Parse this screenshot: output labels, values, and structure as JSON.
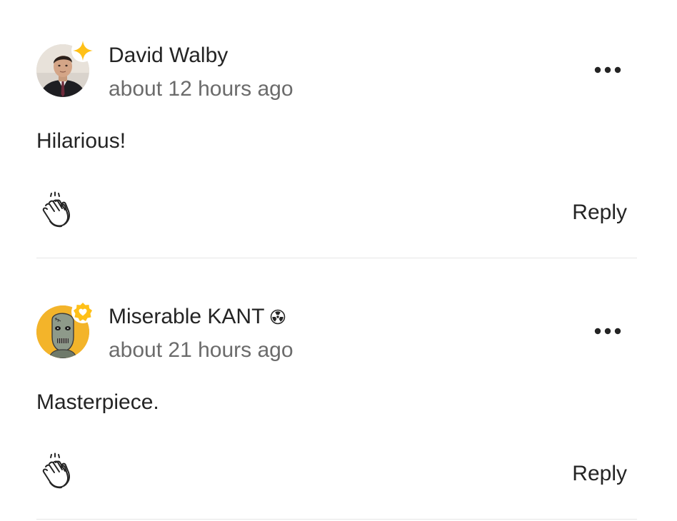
{
  "comments": [
    {
      "author": "David Walby",
      "timestamp": "about 12 hours ago",
      "text": "Hilarious!",
      "reply_label": "Reply",
      "badge": "sparkle-badge-icon",
      "author_suffix_icon": null
    },
    {
      "author": "Miserable KANT",
      "timestamp": "about 21 hours ago",
      "text": "Masterpiece.",
      "reply_label": "Reply",
      "badge": "member-heart-badge-icon",
      "author_suffix_icon": "radioactive-icon"
    }
  ],
  "colors": {
    "text_primary": "#242424",
    "text_secondary": "#6b6b6b",
    "divider": "#e6e6e6",
    "badge_yellow": "#ffc017"
  }
}
